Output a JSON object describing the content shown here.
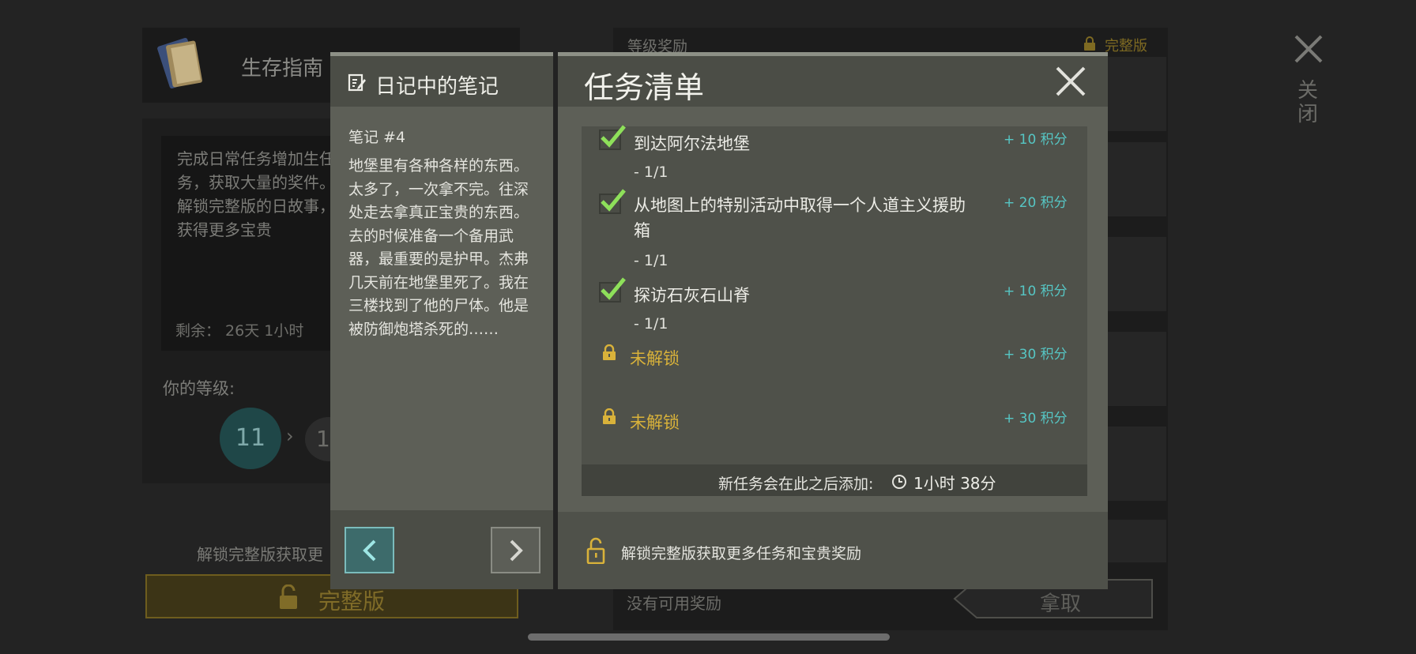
{
  "background": {
    "guide_title": "生存指南",
    "description": "完成日常任务增加生任务，获取大量的奖件。解锁完整版的日故事，获得更多宝贵",
    "remaining": "剩余： 26天 1小时",
    "level_label": "你的等级:",
    "current_level": "11",
    "next_level": "1",
    "unlock_text": "解锁完整版获取更",
    "full_version_button": "完整版",
    "reward_title": "等级奖励",
    "full_version_tag": "完整版",
    "no_reward": "没有可用奖励",
    "take_button": "拿取",
    "close_label": "关闭"
  },
  "note": {
    "title": "日记中的笔记",
    "number": "笔记 #4",
    "text": "地堡里有各种各样的东西。太多了，一次拿不完。往深处走去拿真正宝贵的东西。去的时候准备一个备用武器，最重要的是护甲。杰弗几天前在地堡里死了。我在三楼找到了他的尸体。他是被防御炮塔杀死的……"
  },
  "tasks": {
    "title": "任务清单",
    "items": [
      {
        "name": "到达阿尔法地堡",
        "progress": "- 1/1",
        "points": "+ 10  积分",
        "completed": true
      },
      {
        "name": "从地图上的特别活动中取得一个人道主义援助箱",
        "progress": "- 1/1",
        "points": "+ 20  积分",
        "completed": true
      },
      {
        "name": "探访石灰石山脊",
        "progress": "- 1/1",
        "points": "+ 10  积分",
        "completed": true
      }
    ],
    "locked": [
      {
        "label": "未解锁",
        "points": "+ 30  积分"
      },
      {
        "label": "未解锁",
        "points": "+ 30  积分"
      }
    ],
    "new_task_label": "新任务会在此之后添加:",
    "new_task_time": "1小时 38分",
    "unlock_footer": "解锁完整版获取更多任务和宝贵奖励"
  },
  "colors": {
    "accent_teal": "#56c6c4",
    "locked_gold": "#d9b23a",
    "check_green": "#8ee05a"
  },
  "icons": [
    "book-icon",
    "notepad-icon",
    "close-icon",
    "check-icon",
    "lock-icon",
    "clock-icon",
    "unlock-icon",
    "chevron-left-icon",
    "chevron-right-icon"
  ]
}
